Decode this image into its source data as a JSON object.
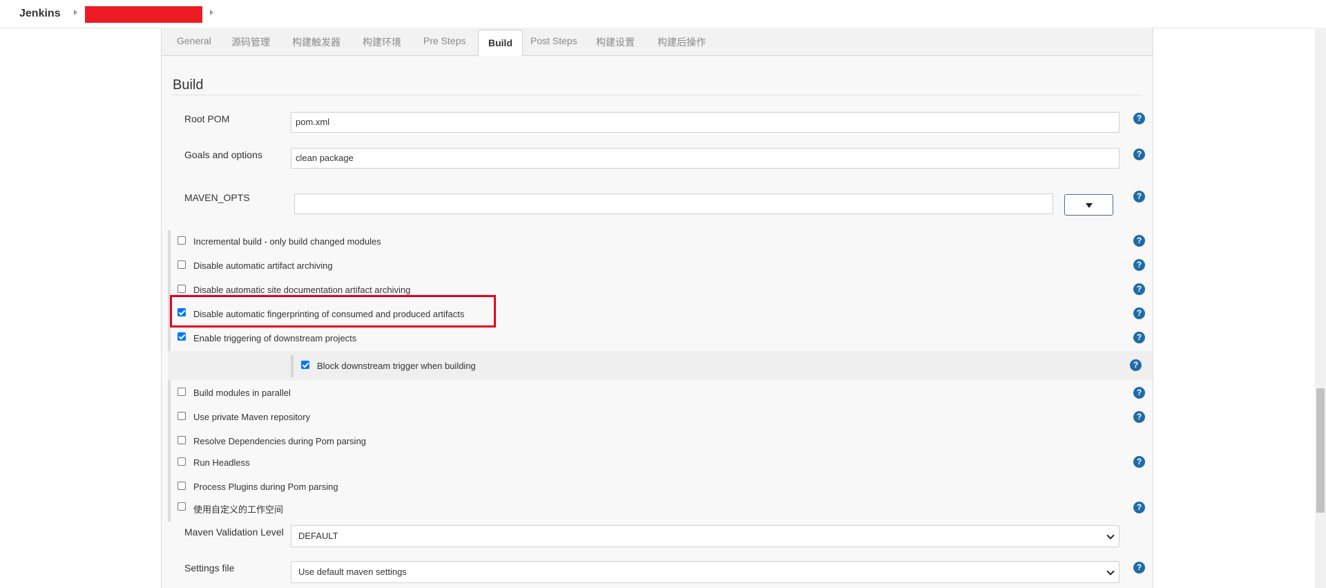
{
  "breadcrumb": {
    "brand": "Jenkins"
  },
  "tabs": [
    {
      "label": "General"
    },
    {
      "label": "源码管理"
    },
    {
      "label": "构建触发器"
    },
    {
      "label": "构建环境"
    },
    {
      "label": "Pre Steps"
    },
    {
      "label": "Build",
      "active": true
    },
    {
      "label": "Post Steps"
    },
    {
      "label": "构建设置"
    },
    {
      "label": "构建后操作"
    }
  ],
  "section": {
    "title": "Build"
  },
  "fields": {
    "root_pom": {
      "label": "Root POM",
      "value": "pom.xml"
    },
    "goals": {
      "label": "Goals and options",
      "value": "clean package"
    },
    "maven_opts": {
      "label": "MAVEN_OPTS",
      "value": ""
    }
  },
  "options": [
    {
      "label": "Incremental build - only build changed modules",
      "checked": false
    },
    {
      "label": "Disable automatic artifact archiving",
      "checked": false
    },
    {
      "label": "Disable automatic site documentation artifact archiving",
      "checked": false
    },
    {
      "label": "Disable automatic fingerprinting of consumed and produced artifacts",
      "checked": true
    },
    {
      "label": "Enable triggering of downstream projects",
      "checked": true
    },
    {
      "label": "Block downstream trigger when building",
      "checked": true
    },
    {
      "label": "Build modules in parallel",
      "checked": false
    },
    {
      "label": "Use private Maven repository",
      "checked": false
    },
    {
      "label": "Resolve Dependencies during Pom parsing",
      "checked": false
    },
    {
      "label": "Run Headless",
      "checked": false
    },
    {
      "label": "Process Plugins during Pom parsing",
      "checked": false
    },
    {
      "label": "使用自定义的工作空间",
      "checked": false
    }
  ],
  "selects": {
    "validation": {
      "label": "Maven Validation Level",
      "value": "DEFAULT"
    },
    "settings": {
      "label": "Settings file",
      "value": "Use default maven settings"
    }
  },
  "help_glyph": "?",
  "colors": {
    "help_icon": "#1f6ba8",
    "checkbox_checked": "#0075ff",
    "highlight_box": "#e3001b",
    "redaction": "#ed1c24"
  }
}
